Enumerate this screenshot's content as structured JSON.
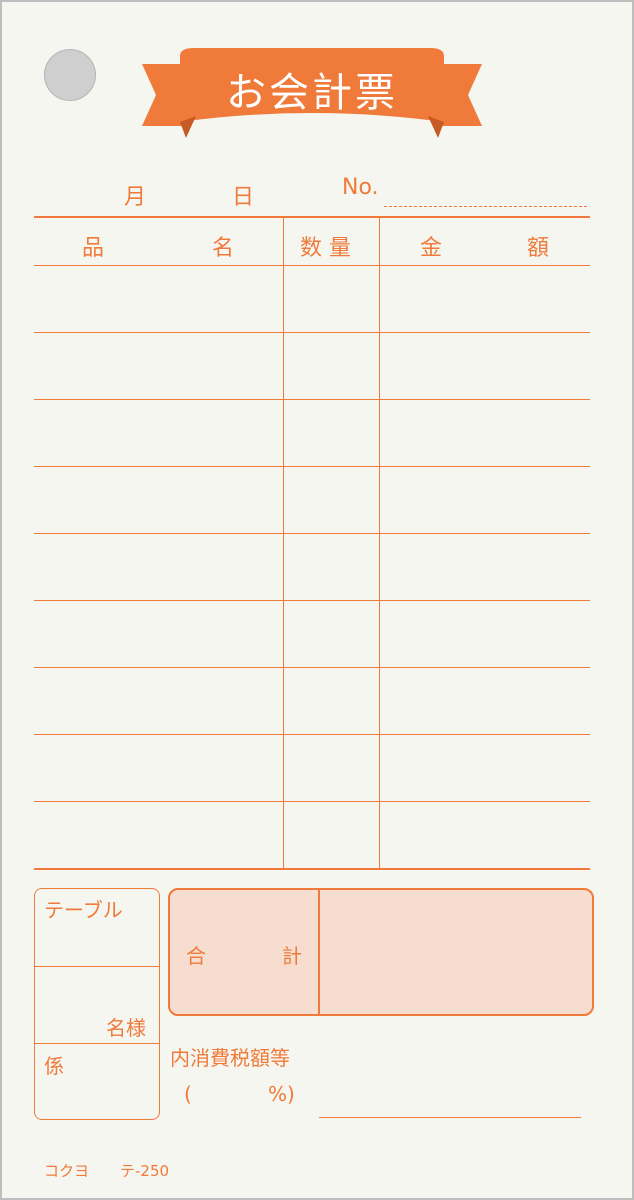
{
  "form": {
    "title": "お会計票",
    "month_label": "月",
    "day_label": "日",
    "no_label": "No."
  },
  "table": {
    "headers": {
      "item_a": "品",
      "item_b": "名",
      "qty": "数 量",
      "amount_a": "金",
      "amount_b": "額"
    },
    "row_count": 9
  },
  "bottom": {
    "table_label": "テーブル",
    "guests_label": "名様",
    "staff_label": "係",
    "total_a": "合",
    "total_b": "計",
    "tax_label": "内消費税額等",
    "tax_open": "(",
    "tax_pct": "%)"
  },
  "footer": {
    "brand": "コクヨ",
    "model": "テ-250"
  },
  "colors": {
    "accent": "#f07a3a",
    "paper": "#f6f6f1",
    "total_fill": "#f7ddd0"
  }
}
